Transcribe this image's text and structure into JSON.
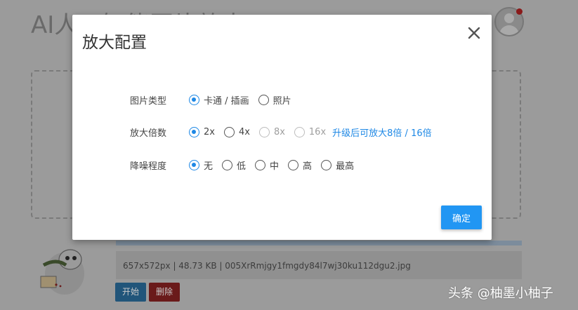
{
  "page": {
    "title": "AI人工智能图片放大",
    "file_info": "657x572px | 48.73 KB | 005XrRmjgy1fmgdy84l7wj30ku112dgu2.jpg",
    "start_label": "开始",
    "delete_label": "删除"
  },
  "watermark": "头条 @柚墨小柚子",
  "modal": {
    "title": "放大配置",
    "rows": [
      {
        "label": "图片类型",
        "options": [
          {
            "label": "卡通 / 插画",
            "checked": true
          },
          {
            "label": "照片",
            "checked": false
          }
        ]
      },
      {
        "label": "放大倍数",
        "options": [
          {
            "label": "2x",
            "checked": true
          },
          {
            "label": "4x",
            "checked": false
          },
          {
            "label": "8x",
            "checked": false,
            "disabled": true
          },
          {
            "label": "16x",
            "checked": false,
            "disabled": true
          }
        ],
        "note": "升级后可放大8倍 / 16倍"
      },
      {
        "label": "降噪程度",
        "options": [
          {
            "label": "无",
            "checked": true
          },
          {
            "label": "低",
            "checked": false
          },
          {
            "label": "中",
            "checked": false
          },
          {
            "label": "高",
            "checked": false
          },
          {
            "label": "最高",
            "checked": false
          }
        ]
      }
    ],
    "confirm_label": "确定"
  },
  "colors": {
    "accent": "#2196f3",
    "overlay": "#9b9b9b",
    "start_button": "#21557a",
    "delete_button": "#6a1a1a"
  },
  "icons": [
    "close-icon",
    "user-avatar-icon",
    "notification-dot-icon",
    "sticker-thumbnail-icon"
  ]
}
